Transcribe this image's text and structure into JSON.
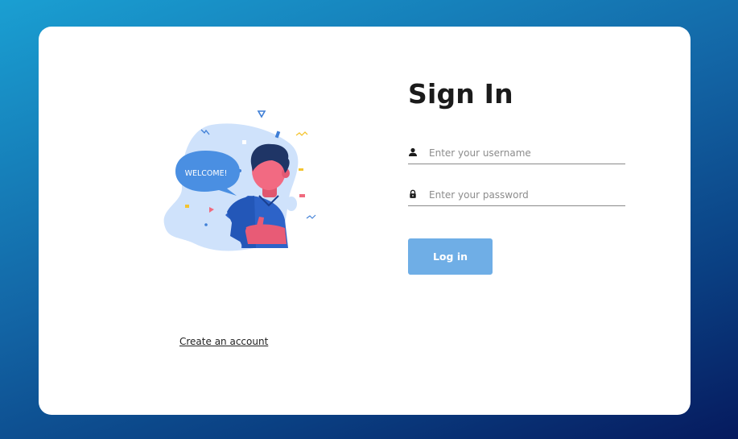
{
  "signin": {
    "title": "Sign In",
    "username_placeholder": "Enter your username",
    "password_placeholder": "Enter your password",
    "login_label": "Log in",
    "create_account_label": "Create an account"
  },
  "illustration": {
    "speech_bubble_text": "WELCOME!"
  },
  "icons": {
    "username": "user-icon",
    "password": "lock-icon"
  },
  "colors": {
    "background_gradient_start": "#1a9fd2",
    "background_gradient_end": "#061a5e",
    "card_background": "#ffffff",
    "button_background": "#6faee6",
    "button_text": "#ffffff",
    "title_text": "#1b1b1b"
  }
}
